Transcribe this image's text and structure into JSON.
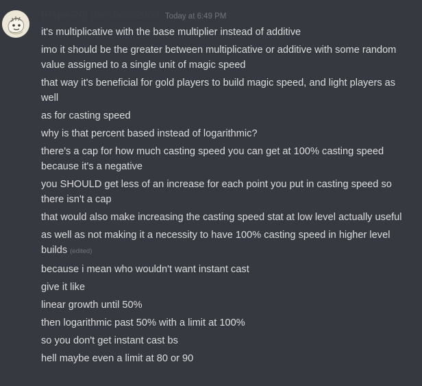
{
  "author": {
    "name": "[Papa-20] pieisboss2003",
    "timestamp": "Today at 6:49 PM",
    "avatar_icon": "user-avatar-icon"
  },
  "messages": [
    {
      "text": "it's multiplicative with the base multiplier instead of additive"
    },
    {
      "text": "imo it should be the greater between multiplicative or additive with some random value assigned to a single unit of magic speed"
    },
    {
      "text": "that way it's beneficial for gold players to build magic speed, and light players as well"
    },
    {
      "text": "as for casting speed"
    },
    {
      "text": "why is that percent based instead of logarithmic?"
    },
    {
      "text": "there's a cap for how much casting speed you can get at 100% casting speed because it's a negative"
    },
    {
      "text": "you SHOULD get less of an increase for each point you put in casting speed so there isn't a cap"
    },
    {
      "text": "that would also make increasing the casting speed stat at low level actually useful"
    },
    {
      "text": "as well as not making it a necessity to have 100% casting speed in higher level builds",
      "edited": "(edited)"
    },
    {
      "text": "because i mean who wouldn't want instant cast"
    },
    {
      "text": "give it like"
    },
    {
      "text": "linear growth until 50%"
    },
    {
      "text": "then logarithmic past 50% with a limit at 100%"
    },
    {
      "text": "so you don't get instant cast bs"
    },
    {
      "text": "hell maybe even a limit at 80 or 90"
    }
  ],
  "colors": {
    "background": "#36393f",
    "message_text": "#dcddde",
    "username": "#3a3d42",
    "timestamp": "#72767d"
  }
}
